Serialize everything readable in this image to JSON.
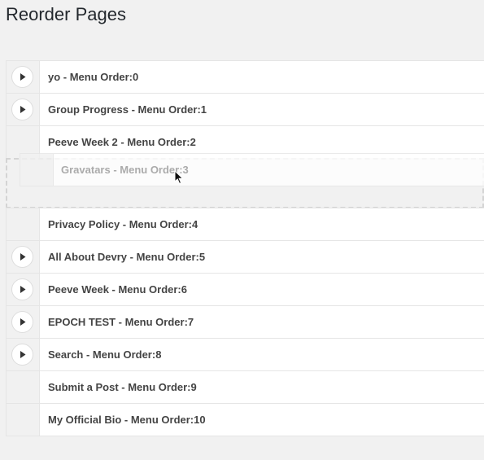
{
  "page": {
    "title": "Reorder Pages"
  },
  "items": [
    {
      "label": "yo - Menu Order:0",
      "has_children": true
    },
    {
      "label": "Group Progress - Menu Order:1",
      "has_children": true
    },
    {
      "label": "Peeve Week 2 - Menu Order:2",
      "has_children": false
    },
    {
      "label": "Privacy Policy - Menu Order:4",
      "has_children": false
    },
    {
      "label": "All About Devry - Menu Order:5",
      "has_children": true
    },
    {
      "label": "Peeve Week - Menu Order:6",
      "has_children": true
    },
    {
      "label": "EPOCH TEST - Menu Order:7",
      "has_children": true
    },
    {
      "label": "Search - Menu Order:8",
      "has_children": true
    },
    {
      "label": "Submit a Post - Menu Order:9",
      "has_children": false
    },
    {
      "label": "My Official Bio - Menu Order:10",
      "has_children": false
    }
  ],
  "dragging_item": {
    "label": "Gravatars - Menu Order:3"
  },
  "icons": {
    "toggle": "play-triangle-icon",
    "cursor": "arrow-cursor-icon"
  }
}
